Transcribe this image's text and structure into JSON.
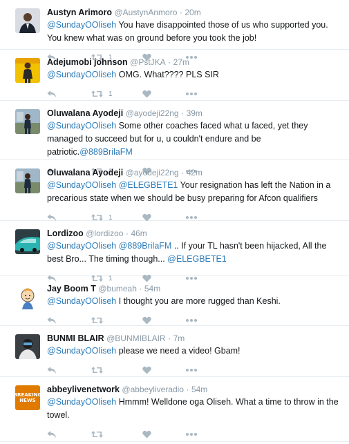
{
  "tweets": [
    {
      "name": "Austyn Arimoro",
      "handle": "@AustynAnmoro",
      "time": "20m",
      "segments": [
        {
          "text": "@SundayOOliseh",
          "mention": true
        },
        {
          "text": " You have disappointed those of us who supported you. You knew what was on ground before you took the job!",
          "mention": false
        }
      ],
      "retweets": "1",
      "avatar": "person-suit"
    },
    {
      "name": "Adejumobi johnson",
      "handle": "@PstJKA",
      "time": "27m",
      "segments": [
        {
          "text": "@SundayOOliseh",
          "mention": true
        },
        {
          "text": " OMG. What???? PLS SIR",
          "mention": false
        }
      ],
      "retweets": "1",
      "avatar": "person-yellow"
    },
    {
      "name": "Oluwalana Ayodeji",
      "handle": "@ayodeji22ng",
      "time": "39m",
      "segments": [
        {
          "text": "@SundayOOliseh",
          "mention": true
        },
        {
          "text": " Some other coaches faced what u faced, yet they managed to succeed but for u, u couldn't endure and be patriotic.",
          "mention": false
        },
        {
          "text": "@889BrilaFM",
          "mention": true
        }
      ],
      "retweets": "1",
      "avatar": "person-outdoor"
    },
    {
      "name": "Oluwalana Ayodeji",
      "handle": "@ayodeji22ng",
      "time": "42m",
      "segments": [
        {
          "text": "@SundayOOliseh",
          "mention": true
        },
        {
          "text": " ",
          "mention": false
        },
        {
          "text": "@ELEGBETE1",
          "mention": true
        },
        {
          "text": " Your resignation has left the Nation in a precarious state when we should be busy preparing for Afcon qualifiers",
          "mention": false
        }
      ],
      "retweets": "1",
      "avatar": "person-outdoor"
    },
    {
      "name": "Lordizoo",
      "handle": "@lordizoo",
      "time": "46m",
      "segments": [
        {
          "text": "@SundayOOliseh",
          "mention": true
        },
        {
          "text": " ",
          "mention": false
        },
        {
          "text": "@889BrilaFM",
          "mention": true
        },
        {
          "text": " .. If your TL hasn't been hijacked, All the best Bro... The timing though... ",
          "mention": false
        },
        {
          "text": "@ELEGBETE1",
          "mention": true
        }
      ],
      "retweets": "1",
      "avatar": "teal-car"
    },
    {
      "name": "Jay Boom T",
      "handle": "@bumeah",
      "time": "54m",
      "segments": [
        {
          "text": "@SundayOOliseh",
          "mention": true
        },
        {
          "text": " I thought you are more rugged than Keshi.",
          "mention": false
        }
      ],
      "retweets": "",
      "avatar": "cartoon"
    },
    {
      "name": "BUNMI BLAIR",
      "handle": "@BUNMIBLAIR",
      "time": "7m",
      "segments": [
        {
          "text": "@SundayOOliseh",
          "mention": true
        },
        {
          "text": " please we need a video! Gbam!",
          "mention": false
        }
      ],
      "retweets": "",
      "avatar": "person-dark"
    },
    {
      "name": "abbeylivenetwork",
      "handle": "@abbeyliveradio",
      "time": "54m",
      "segments": [
        {
          "text": "@SundayOOliseh",
          "mention": true
        },
        {
          "text": " Hmmm! Welldone oga Oliseh. What a time to throw in the towel.",
          "mention": false
        }
      ],
      "retweets": "",
      "avatar": "breaking-news",
      "avatar_text": [
        "BREAKING",
        "NEWS"
      ]
    }
  ],
  "separator": "·",
  "colors": {
    "mention": "#2b7bb9",
    "meta": "#8899a6",
    "icon": "#aab8c2",
    "divider": "#e6ecf0"
  },
  "icons": [
    "reply-icon",
    "retweet-icon",
    "like-icon",
    "more-icon"
  ]
}
